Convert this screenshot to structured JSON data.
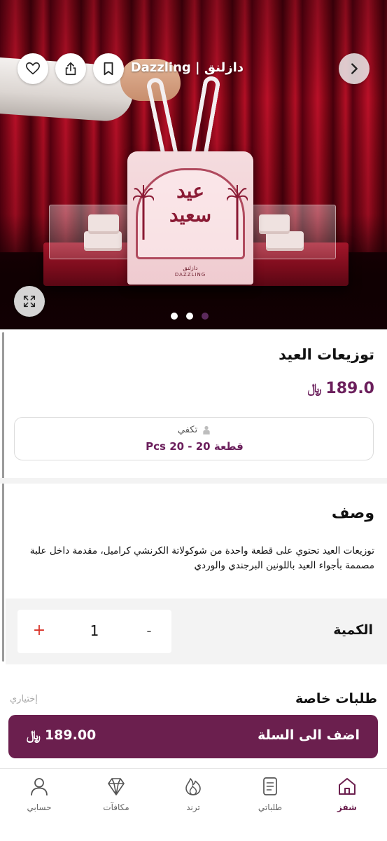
{
  "hero": {
    "title": "Dazzling | دازلنق",
    "bag_text_line1": "عيد",
    "bag_text_line2": "سعيد",
    "bag_brand_ar": "دازلنق",
    "bag_brand_en": "DAZZLING",
    "carousel_dots": 3,
    "active_dot": 2
  },
  "product": {
    "title": "توزيعات العيد",
    "price": "189.0",
    "currency_symbol": "⃁",
    "serves_label": "تكفي",
    "serves_value": "قطعة 20 - 20 Pcs"
  },
  "description": {
    "title": "وصف",
    "text": "توزيعات العيد تحتوي على قطعة واحدة من شوكولاتة الكرنشي كراميل، مقدمة داخل علبة مصممة بأجواء العيد باللونين البرجندي والوردي"
  },
  "quantity": {
    "label": "الكمية",
    "value": "1",
    "plus": "+",
    "minus": "-"
  },
  "special_requests": {
    "title": "طلبات خاصة",
    "optional": "إختياري"
  },
  "cart": {
    "label": "اضف الى السلة",
    "price": "189.00"
  },
  "nav": {
    "items": [
      {
        "label": "شفز",
        "icon": "home-icon",
        "active": true
      },
      {
        "label": "طلباتي",
        "icon": "orders-icon",
        "active": false
      },
      {
        "label": "ترند",
        "icon": "trend-icon",
        "active": false
      },
      {
        "label": "مكافآت",
        "icon": "rewards-icon",
        "active": false
      },
      {
        "label": "حسابي",
        "icon": "profile-icon",
        "active": false
      }
    ]
  },
  "colors": {
    "brand": "#6b1f4e",
    "price": "#6b1f5c",
    "plus": "#d9342a"
  }
}
